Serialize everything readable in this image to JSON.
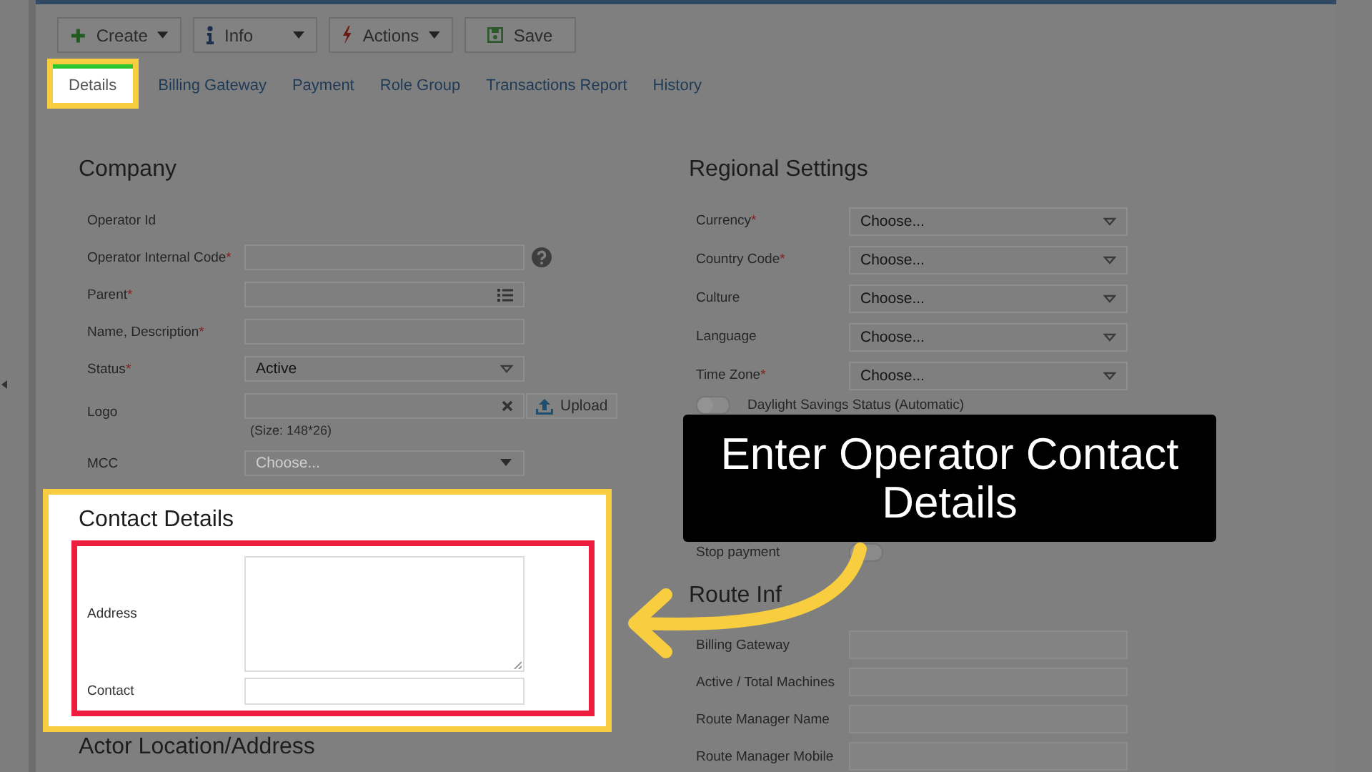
{
  "toolbar": [
    {
      "label": "Create",
      "kind": "plus",
      "dropdown": true
    },
    {
      "label": "Info",
      "kind": "info",
      "dropdown": true
    },
    {
      "label": "Actions",
      "kind": "bolt",
      "dropdown": true
    },
    {
      "label": "Save",
      "kind": "save",
      "dropdown": false
    }
  ],
  "tabs": [
    {
      "label": "Details",
      "selected": true
    },
    {
      "label": "Billing Gateway",
      "selected": false
    },
    {
      "label": "Payment",
      "selected": false
    },
    {
      "label": "Role Group",
      "selected": false
    },
    {
      "label": "Transactions Report",
      "selected": false
    },
    {
      "label": "History",
      "selected": false
    }
  ],
  "company": {
    "title": "Company",
    "fields": [
      {
        "label": "Operator Id",
        "help": false,
        "kind": "none"
      },
      {
        "label": "Operator Internal Code",
        "required_mark": "*",
        "help": true,
        "kind": "text"
      },
      {
        "label": "Parent",
        "required_mark": "*",
        "help": false,
        "kind": "list"
      },
      {
        "label": "Name, Description",
        "required_mark": "*",
        "help": false,
        "kind": "text"
      },
      {
        "label": "Status",
        "required_mark": "*",
        "help": false,
        "kind": "select",
        "value": "Active"
      },
      {
        "label": "Logo",
        "help": false,
        "kind": "file",
        "button": "Upload",
        "hint": "(Size: 148*26)"
      },
      {
        "label": "MCC",
        "help": false,
        "kind": "combo",
        "placeholder": "Choose..."
      }
    ]
  },
  "contact": {
    "title": "Contact Details",
    "fields": [
      {
        "label": "Address",
        "kind": "textarea"
      },
      {
        "label": "Contact",
        "kind": "text"
      }
    ]
  },
  "actor_location": {
    "title": "Actor Location/Address"
  },
  "regional": {
    "title": "Regional Settings",
    "fields": [
      {
        "label": "Currency",
        "required_mark": "*",
        "value": "Choose..."
      },
      {
        "label": "Country Code",
        "required_mark": "*",
        "value": "Choose..."
      },
      {
        "label": "Culture",
        "value": "Choose..."
      },
      {
        "label": "Language",
        "value": "Choose..."
      },
      {
        "label": "Time Zone",
        "required_mark": "*",
        "value": "Choose..."
      }
    ],
    "toggles": [
      {
        "label": "Daylight Savings Status (Automatic)",
        "on": false
      },
      {
        "label": "Stop payment",
        "on": false
      }
    ]
  },
  "route": {
    "title": "Route Inf",
    "fields": [
      {
        "label": "Billing Gateway"
      },
      {
        "label": "Active / Total Machines"
      },
      {
        "label": "Route Manager Name"
      },
      {
        "label": "Route Manager Mobile"
      }
    ]
  },
  "callout": {
    "text": "Enter Operator Contact Details"
  }
}
